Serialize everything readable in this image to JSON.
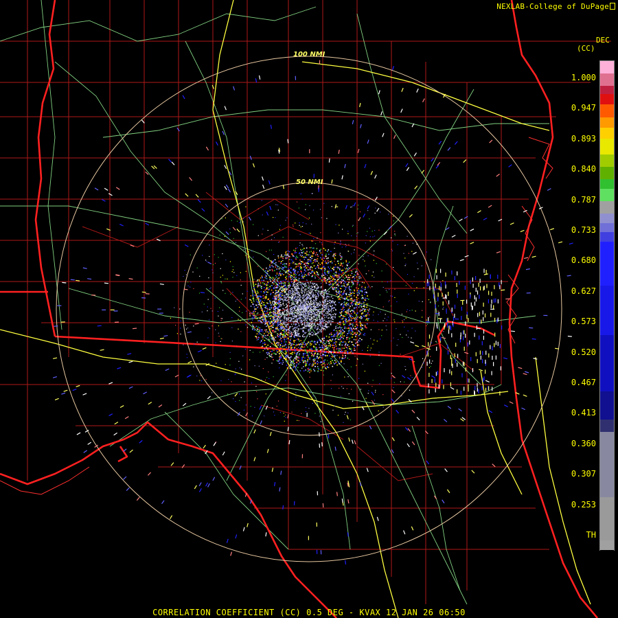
{
  "header": {
    "credit": "NEXLAB-College of DuPage",
    "credit_icon": "corner-logo-icon"
  },
  "product": {
    "code_line1": "DEC",
    "code_line2": "(CC)"
  },
  "rings": [
    {
      "label": "100 NMI"
    },
    {
      "label": "50 NMI"
    }
  ],
  "colorbar": {
    "labels": [
      "1.000",
      "0.947",
      "0.893",
      "0.840",
      "0.787",
      "0.733",
      "0.680",
      "0.627",
      "0.573",
      "0.520",
      "0.467",
      "0.413",
      "0.360",
      "0.307",
      "0.253",
      "TH"
    ],
    "stops": [
      {
        "value": 1.0,
        "color": "#ffb0d8"
      },
      {
        "value": 0.98,
        "color": "#e07090"
      },
      {
        "value": 0.96,
        "color": "#c02040"
      },
      {
        "value": 0.947,
        "color": "#e01010"
      },
      {
        "value": 0.93,
        "color": "#ff5a00"
      },
      {
        "value": 0.91,
        "color": "#ff9a00"
      },
      {
        "value": 0.893,
        "color": "#ffd000"
      },
      {
        "value": 0.875,
        "color": "#e8e800"
      },
      {
        "value": 0.85,
        "color": "#a0cc00"
      },
      {
        "value": 0.83,
        "color": "#60b000"
      },
      {
        "value": 0.81,
        "color": "#30c030"
      },
      {
        "value": 0.795,
        "color": "#60e060"
      },
      {
        "value": 0.775,
        "color": "#a0a0a0"
      },
      {
        "value": 0.755,
        "color": "#9090d0"
      },
      {
        "value": 0.74,
        "color": "#7070d8"
      },
      {
        "value": 0.725,
        "color": "#4040e0"
      },
      {
        "value": 0.71,
        "color": "#2020ff"
      },
      {
        "value": 0.64,
        "color": "#1818e8"
      },
      {
        "value": 0.56,
        "color": "#1010c0"
      },
      {
        "value": 0.47,
        "color": "#101090"
      },
      {
        "value": 0.425,
        "color": "#303070"
      },
      {
        "value": 0.405,
        "color": "#8888a0"
      },
      {
        "value": 0.3,
        "color": "#9a9a9a"
      },
      {
        "value": 0.23,
        "color": "#a0a0a0"
      },
      {
        "value": 0.215,
        "color": "#000000"
      }
    ]
  },
  "footer": {
    "caption": "CORRELATION COEFFICIENT (CC) 0.5 DEG - KVAX 12 JAN 26 06:50"
  },
  "colors": {
    "state_border": "#ff2020",
    "county_border": "#b01818",
    "highway": "#ffff40",
    "road": "#90e890",
    "range_ring": "#e8c8a0",
    "text": "#ffff00"
  }
}
